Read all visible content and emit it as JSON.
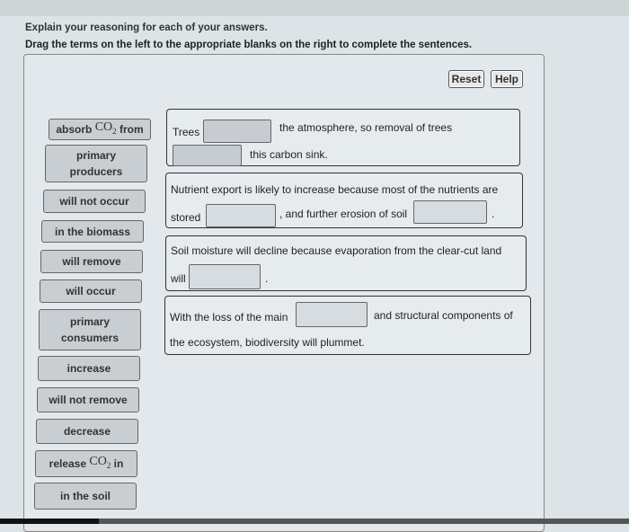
{
  "instructions": {
    "line1": "Explain your reasoning for each of your answers.",
    "line2": "Drag the terms on the left to the appropriate blanks on the right to complete the sentences."
  },
  "toolbar": {
    "reset_label": "Reset",
    "help_label": "Help"
  },
  "terms": [
    {
      "label_pre": "absorb ",
      "label_chem": "CO",
      "label_sub": "2",
      "label_post": " from"
    },
    {
      "label": "primary producers"
    },
    {
      "label": "will not occur"
    },
    {
      "label": "in the biomass"
    },
    {
      "label": "will remove"
    },
    {
      "label": "will occur"
    },
    {
      "label": "primary consumers"
    },
    {
      "label": "increase"
    },
    {
      "label": "will not remove"
    },
    {
      "label": "decrease"
    },
    {
      "label_pre": "release ",
      "label_chem": "CO",
      "label_sub": "2",
      "label_post": " in"
    },
    {
      "label": "in the soil"
    }
  ],
  "sentences": [
    {
      "parts": [
        "Trees",
        "the atmosphere, so removal of trees",
        "this carbon sink."
      ]
    },
    {
      "parts": [
        "Nutrient export is likely to increase because most of the nutrients are",
        "stored",
        ", and further erosion of soil",
        "."
      ]
    },
    {
      "parts": [
        "Soil moisture will decline because evaporation from the clear-cut land",
        "will",
        "."
      ]
    },
    {
      "parts": [
        "With the loss of the main",
        "and structural components of",
        "the ecosystem, biodiversity will plummet."
      ]
    }
  ]
}
